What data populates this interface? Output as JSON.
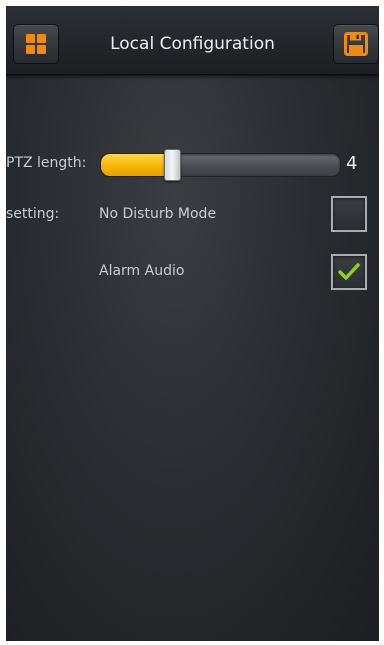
{
  "header": {
    "title": "Local Configuration",
    "left_icon": "grid-menu-icon",
    "right_icon": "floppy-save-icon"
  },
  "settings": {
    "ptz_label": "PTZ length:",
    "ptz_value": "4",
    "ptz_slider_fraction": 0.28,
    "setting_label": "setting:",
    "options": [
      {
        "label": "No Disturb Mode",
        "checked": false
      },
      {
        "label": "Alarm Audio",
        "checked": true
      }
    ]
  },
  "colors": {
    "accent_orange": "#f08a10",
    "slider_fill": "#f7b500",
    "check_green": "#8fd11a"
  }
}
